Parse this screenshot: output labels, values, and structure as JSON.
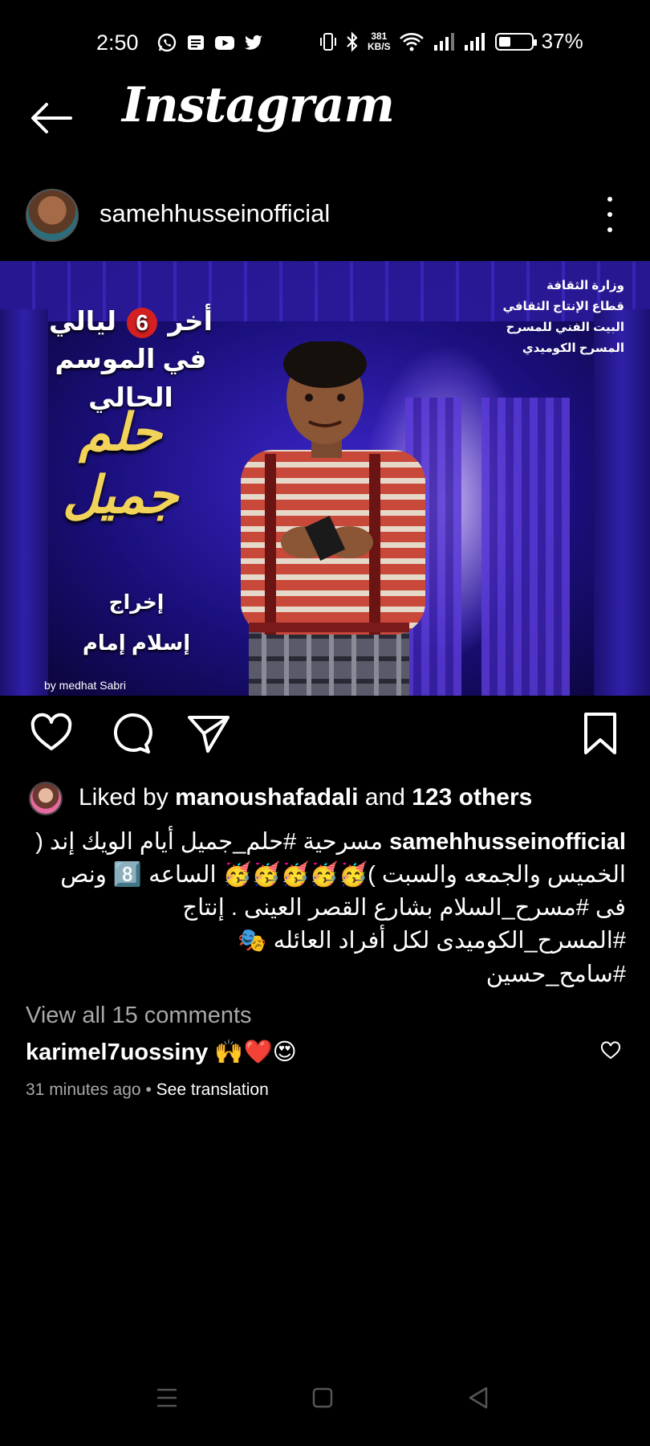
{
  "status_bar": {
    "time": "2:50",
    "apps": [
      "whatsapp-icon",
      "messages-icon",
      "youtube-icon",
      "twitter-icon"
    ],
    "net_speed_value": "381",
    "net_speed_unit": "KB/S",
    "battery": "37%",
    "battery_level": 0.37
  },
  "header": {
    "title": "Instagram"
  },
  "post": {
    "username": "samehhusseinofficial",
    "poster": {
      "ministry_lines": [
        "وزارة الثقافة",
        "قطاع الإنتاج الثقافي",
        "البيت الفني للمسرح",
        "المسرح الكوميدي"
      ],
      "headline_pre": "أخر",
      "headline_num": "6",
      "headline_post": "ليالي",
      "headline_line2": "في الموسم الحالي",
      "title_line1": "حلم",
      "title_line2": "جميل",
      "director_label": "إخراج",
      "director_name": "إسلام إمام",
      "credit": "by medhat Sabri"
    },
    "liked_by_prefix": "Liked by",
    "liked_by_user": "manoushafadali",
    "liked_by_and": "and",
    "liked_by_others": "123 others",
    "caption_user": "samehhusseinofficial",
    "caption_text": "مسرحية #حلم_جميل  أيام الويك إند ( الخميس والجمعه والسبت )🥳🥳🥳🥳🥳 الساعه 8️⃣ ونص فى #مسرح_السلام بشارع القصر العينى . إنتاج #المسرح_الكوميدى لكل أفراد العائله 🎭",
    "caption_hashtag": "#سامح_حسين",
    "view_all_comments": "View all 15 comments",
    "comment_user": "karimel7uossiny",
    "comment_text": "🙌❤️😍",
    "time_ago": "31 minutes ago",
    "separator": "•",
    "see_translation": "See translation"
  }
}
